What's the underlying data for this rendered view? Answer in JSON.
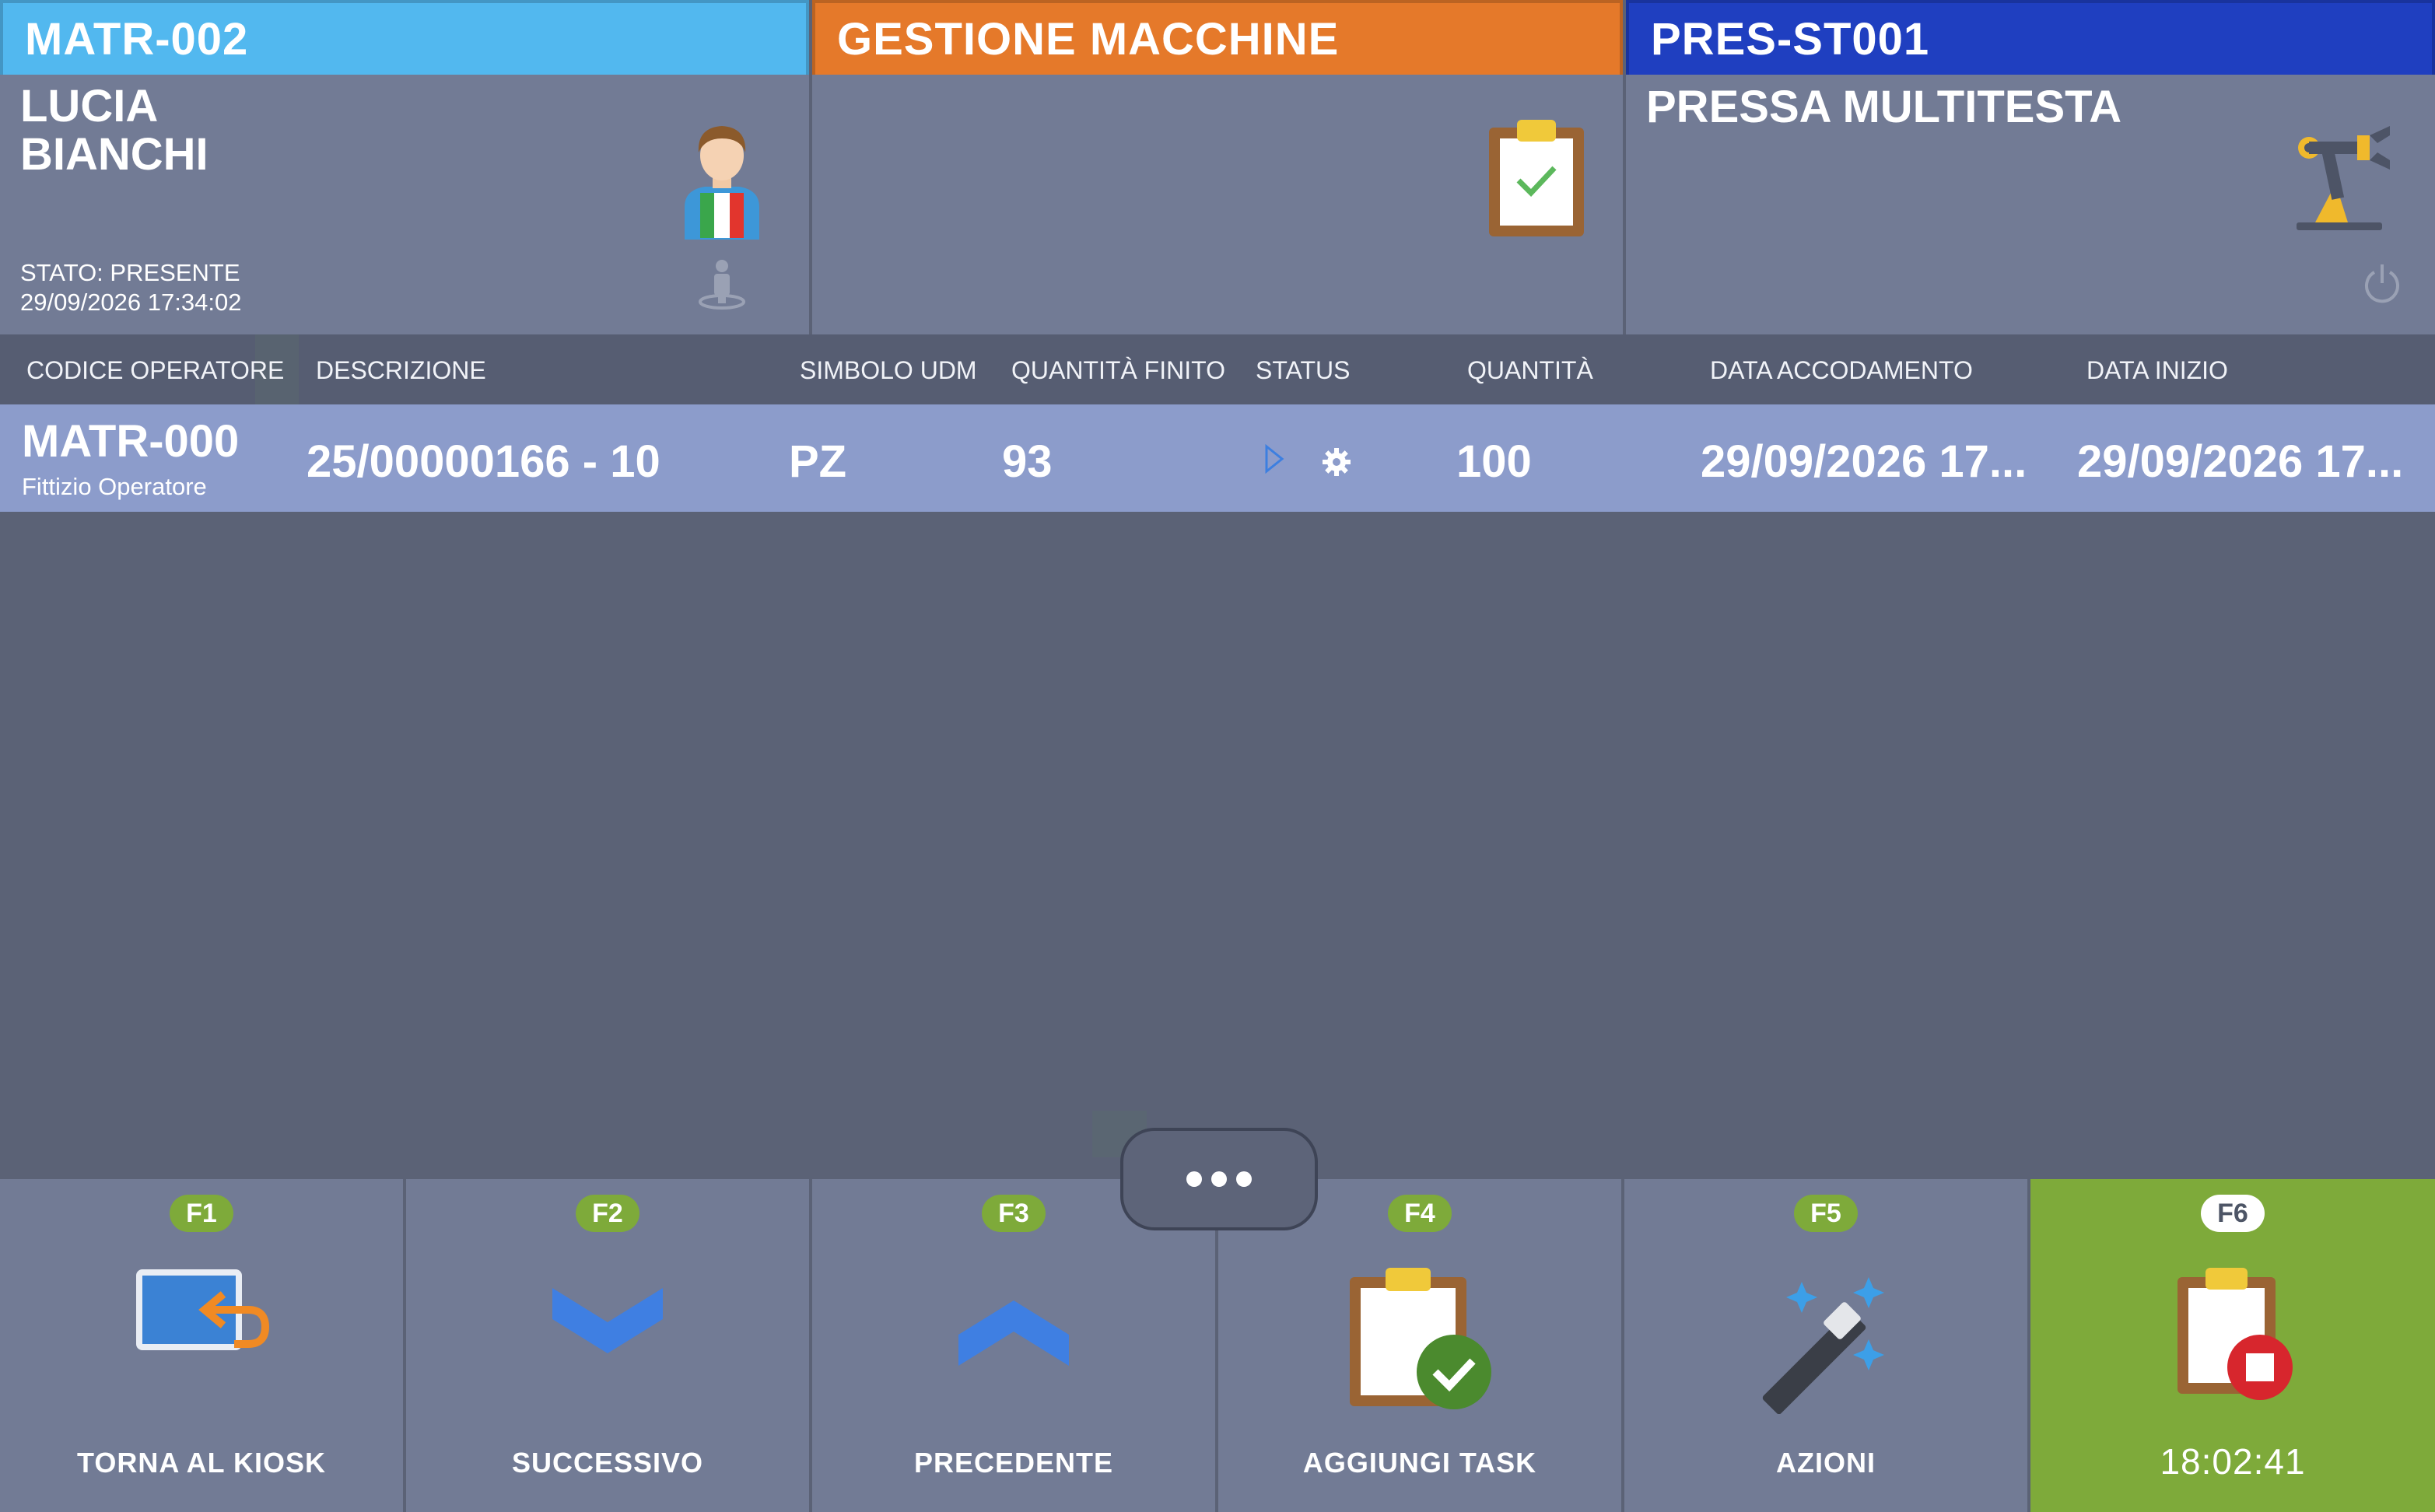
{
  "operator": {
    "code": "MATR-002",
    "name_line1": "LUCIA",
    "name_line2": "BIANCHI",
    "status": "STATO: PRESENTE",
    "timestamp": "29/09/2026 17:34:02"
  },
  "app": {
    "title": "GESTIONE MACCHINE"
  },
  "machine": {
    "code": "PRES-ST001",
    "name": "PRESSA MULTITESTA"
  },
  "table": {
    "headers": [
      "CODICE OPERATORE",
      "DESCRIZIONE",
      "SIMBOLO UDM",
      "QUANTITÀ FINITO",
      "STATUS",
      "QUANTITÀ",
      "DATA ACCODAMENTO",
      "DATA INIZIO"
    ],
    "rows": [
      {
        "operator_code": "MATR-000",
        "operator_name": "Fittizio Operatore",
        "description": "25/00000166 - 10",
        "udm": "PZ",
        "finished_qty": "93",
        "status_icons": [
          "play-icon",
          "gear-icon"
        ],
        "qty": "100",
        "queue_date": "29/09/2026 17...",
        "start_date": "29/09/2026 17..."
      }
    ]
  },
  "footer": {
    "buttons": [
      {
        "key": "F1",
        "label": "TORNA AL KIOSK",
        "icon": "return-to-kiosk-icon"
      },
      {
        "key": "F2",
        "label": "SUCCESSIVO",
        "icon": "chevron-down-icon"
      },
      {
        "key": "F3",
        "label": "PRECEDENTE",
        "icon": "chevron-up-icon"
      },
      {
        "key": "F4",
        "label": "AGGIUNGI TASK",
        "icon": "clipboard-check-icon"
      },
      {
        "key": "F5",
        "label": "AZIONI",
        "icon": "magic-wand-icon"
      },
      {
        "key": "F6",
        "label": "18:02:41",
        "icon": "clipboard-stop-icon"
      }
    ]
  },
  "colors": {
    "operator_header": "#52b8ef",
    "app_header": "#e5792a",
    "machine_header": "#1f3fc0",
    "selected_row": "#8c9ccb",
    "active_button": "#7eaa3a",
    "key_badge": "#7eaa3a"
  }
}
